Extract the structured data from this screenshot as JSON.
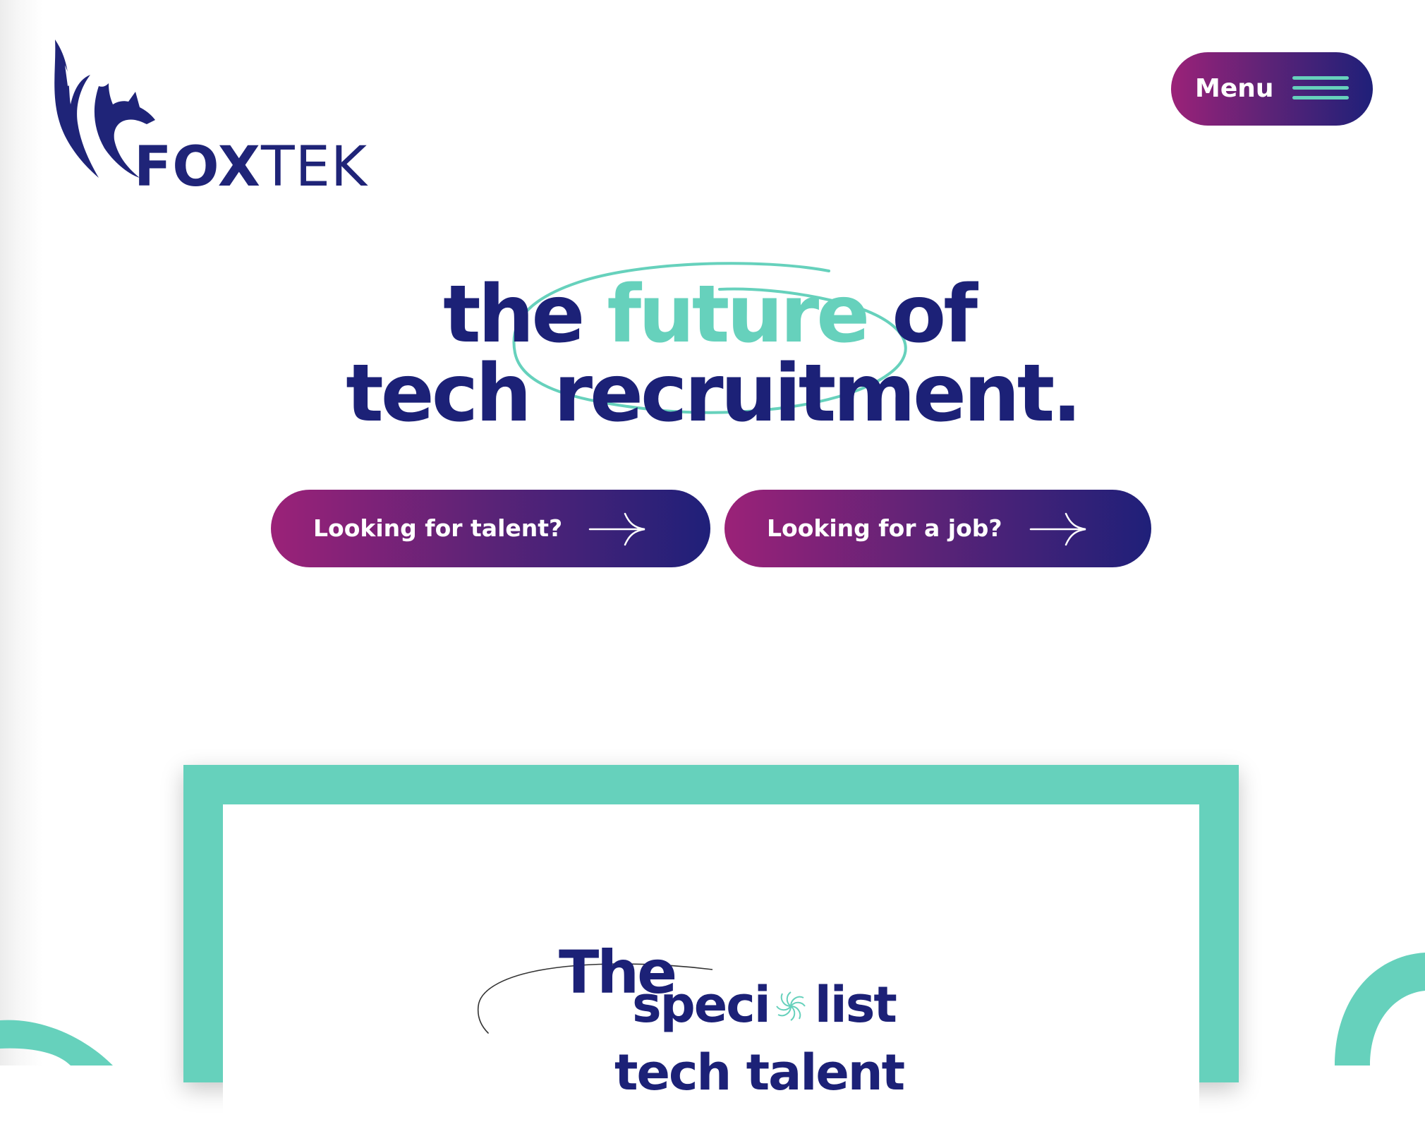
{
  "brand": {
    "name_bold": "FOX",
    "name_light": "TEK",
    "primary_color": "#1f2478",
    "accent_color": "#66d1bc",
    "gradient_start": "#9b2278",
    "gradient_end": "#1f2079"
  },
  "header": {
    "menu_label": "Menu",
    "menu_icon": "hamburger-icon"
  },
  "hero": {
    "line1_pre": "the ",
    "line1_accent": "future",
    "line1_post": " of",
    "line2": "tech recruitment."
  },
  "cta": {
    "talent_label": "Looking for talent?",
    "job_label": "Looking for a job?",
    "arrow_icon": "arrow-right-icon"
  },
  "card": {
    "the": "The",
    "word_part1": "speci",
    "word_part2": "list",
    "next_line": "tech talent"
  }
}
